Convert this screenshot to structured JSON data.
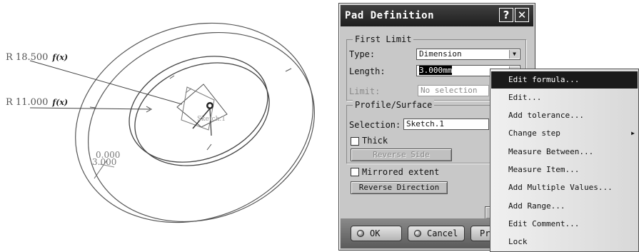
{
  "viewport": {
    "dimensions": [
      {
        "value": "R 18.500",
        "fx": "f(x)"
      },
      {
        "value": "R 11.000",
        "fx": "f(x)"
      }
    ],
    "small_labels": [
      "0.000",
      "3.000",
      "Sketch.1"
    ]
  },
  "dialog": {
    "title": "Pad Definition",
    "help_button": "?",
    "close_button": "✕",
    "first_limit": {
      "legend": "First Limit",
      "type_label": "Type:",
      "type_value": "Dimension",
      "length_label": "Length:",
      "length_value": "3.000mm",
      "limit_label": "Limit:",
      "limit_value": "No selection"
    },
    "profile_surface": {
      "legend": "Profile/Surface",
      "selection_label": "Selection:",
      "selection_value": "Sketch.1",
      "thick_label": "Thick",
      "reverse_side_label": "Reverse Side"
    },
    "mirrored_extent_label": "Mirrored extent",
    "reverse_direction_label": "Reverse Direction",
    "more_button": "",
    "ok_label": "OK",
    "cancel_label": "Cancel",
    "preview_label": "Pr"
  },
  "context_menu": {
    "items": [
      {
        "label": "Edit formula...",
        "active": true
      },
      {
        "label": "Edit..."
      },
      {
        "label": "Add tolerance..."
      },
      {
        "label": "Change step",
        "submenu": true
      },
      {
        "label": "Measure Between..."
      },
      {
        "label": "Measure Item..."
      },
      {
        "label": "Add Multiple Values..."
      },
      {
        "label": "Add Range..."
      },
      {
        "label": "Edit Comment..."
      },
      {
        "label": "Lock"
      }
    ]
  }
}
